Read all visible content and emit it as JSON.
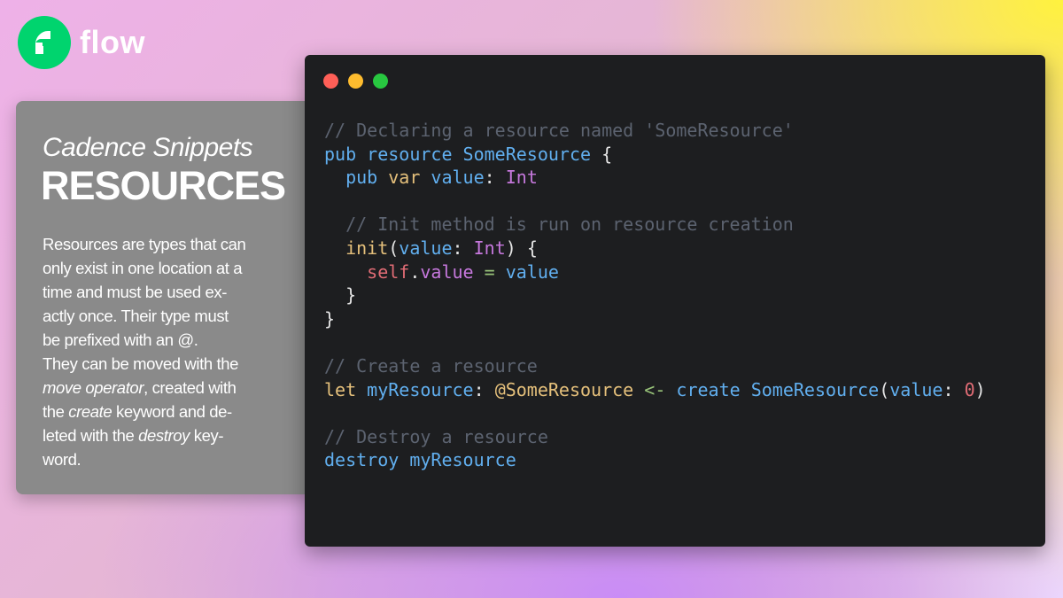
{
  "brand": {
    "name": "flow",
    "colors": {
      "mark": "#00d46e",
      "text": "#ffffff"
    }
  },
  "info": {
    "subtitle": "Cadence Snippets",
    "title": "RESOURCES",
    "description": [
      [
        {
          "t": "Resources are types that can"
        }
      ],
      [
        {
          "t": "only exist in one location at a"
        }
      ],
      [
        {
          "t": "time and must be used ex-"
        }
      ],
      [
        {
          "t": "actly once. Their type must"
        }
      ],
      [
        {
          "t": "be prefixed with an @."
        }
      ],
      [
        {
          "t": "They can be moved with the"
        }
      ],
      [
        {
          "t": "move operator",
          "i": true
        },
        {
          "t": ", created with"
        }
      ],
      [
        {
          "t": "the "
        },
        {
          "t": "create",
          "i": true
        },
        {
          "t": " keyword and de-"
        }
      ],
      [
        {
          "t": "leted with the "
        },
        {
          "t": "destroy",
          "i": true
        },
        {
          "t": " key-"
        }
      ],
      [
        {
          "t": "word."
        }
      ]
    ]
  },
  "window": {
    "dots": [
      "#ff5f57",
      "#febc2e",
      "#28c840"
    ]
  },
  "syntax_colors": {
    "comment": "#5c6370",
    "keyword": "#61afef",
    "type": "#c678dd",
    "func": "#e5c07b",
    "self": "#e06c75",
    "op": "#98c379",
    "num": "#e06c75",
    "punct": "#e6e6e6",
    "typeName": "#61afef",
    "param": "#61afef",
    "resource": "#e5c07b"
  },
  "code": [
    [
      {
        "t": "// Declaring a resource named 'SomeResource'",
        "c": "comment"
      }
    ],
    [
      {
        "t": "pub resource ",
        "c": "keyword"
      },
      {
        "t": "SomeResource",
        "c": "typeName"
      },
      {
        "t": " {",
        "c": "punct"
      }
    ],
    [
      {
        "t": "  pub ",
        "c": "keyword"
      },
      {
        "t": "var ",
        "c": "func"
      },
      {
        "t": "value",
        "c": "param"
      },
      {
        "t": ": ",
        "c": "punct"
      },
      {
        "t": "Int",
        "c": "type"
      }
    ],
    [],
    [
      {
        "t": "  // Init method is run on resource creation",
        "c": "comment"
      }
    ],
    [
      {
        "t": "  init",
        "c": "func"
      },
      {
        "t": "(",
        "c": "punct"
      },
      {
        "t": "value",
        "c": "param"
      },
      {
        "t": ": ",
        "c": "punct"
      },
      {
        "t": "Int",
        "c": "type"
      },
      {
        "t": ") {",
        "c": "punct"
      }
    ],
    [
      {
        "t": "    self",
        "c": "self"
      },
      {
        "t": ".",
        "c": "punct"
      },
      {
        "t": "value",
        "c": "type"
      },
      {
        "t": " = ",
        "c": "op"
      },
      {
        "t": "value",
        "c": "param"
      }
    ],
    [
      {
        "t": "  }",
        "c": "punct"
      }
    ],
    [
      {
        "t": "}",
        "c": "punct"
      }
    ],
    [],
    [
      {
        "t": "// Create a resource",
        "c": "comment"
      }
    ],
    [
      {
        "t": "let ",
        "c": "func"
      },
      {
        "t": "myResource",
        "c": "param"
      },
      {
        "t": ": ",
        "c": "punct"
      },
      {
        "t": "@SomeResource",
        "c": "resource"
      },
      {
        "t": " <- ",
        "c": "op"
      },
      {
        "t": "create ",
        "c": "keyword"
      },
      {
        "t": "SomeResource",
        "c": "typeName"
      },
      {
        "t": "(",
        "c": "punct"
      },
      {
        "t": "value",
        "c": "param"
      },
      {
        "t": ": ",
        "c": "punct"
      },
      {
        "t": "0",
        "c": "num"
      },
      {
        "t": ")",
        "c": "punct"
      }
    ],
    [],
    [
      {
        "t": "// Destroy a resource",
        "c": "comment"
      }
    ],
    [
      {
        "t": "destroy ",
        "c": "keyword"
      },
      {
        "t": "myResource",
        "c": "param"
      }
    ]
  ]
}
